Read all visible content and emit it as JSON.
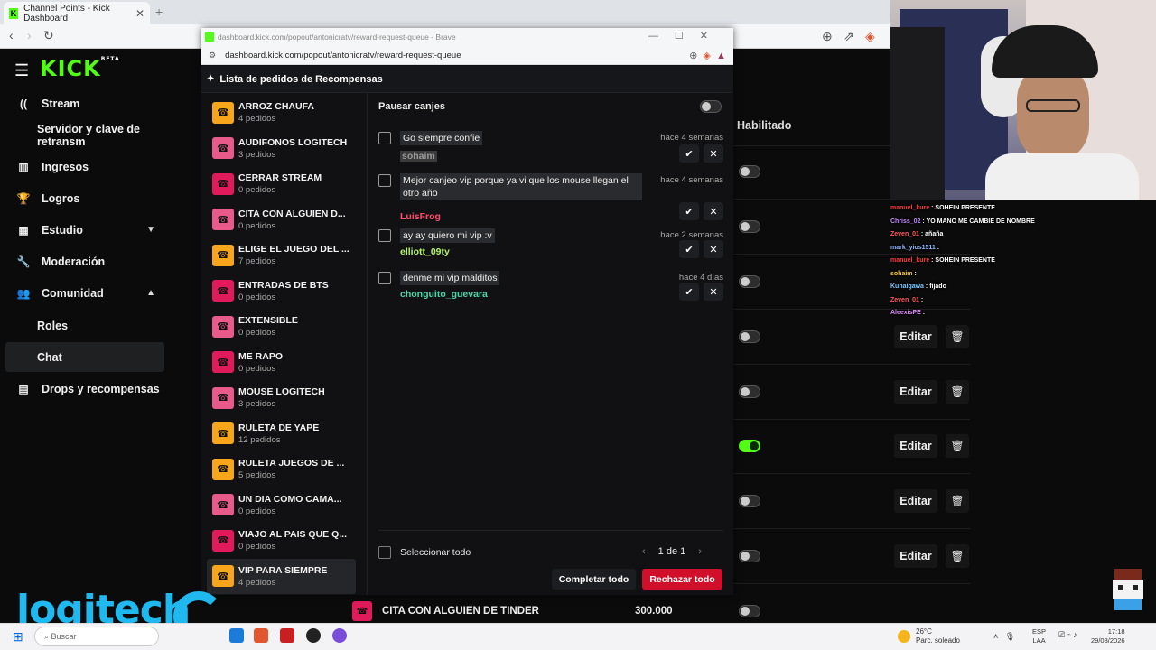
{
  "browser": {
    "tab_title": "Channel Points - Kick Dashboard",
    "tab_close": "✕",
    "new_tab": "+"
  },
  "kick": {
    "logo": "KICK",
    "logo_beta": "BETA",
    "nav": [
      {
        "label": "Stream",
        "icon": "broadcast-icon"
      },
      {
        "label": "Servidor y clave de retransm",
        "icon": ""
      },
      {
        "label": "Ingresos",
        "icon": "chart-icon"
      },
      {
        "label": "Logros",
        "icon": "trophy-icon"
      },
      {
        "label": "Estudio",
        "icon": "studio-icon"
      },
      {
        "label": "Moderación",
        "icon": "wrench-icon"
      },
      {
        "label": "Comunidad",
        "icon": "people-icon"
      },
      {
        "label": "Roles",
        "icon": ""
      },
      {
        "label": "Chat",
        "icon": ""
      },
      {
        "label": "Drops y recompensas",
        "icon": "gift-icon"
      }
    ],
    "table_header": "Habilitado",
    "edit_label": "Editar",
    "bottom_row": {
      "name": "CITA CON ALGUIEN DE TINDER",
      "cost": "300.000"
    },
    "rows_enabled": [
      false,
      false,
      false,
      false,
      false,
      true,
      false,
      false,
      false
    ]
  },
  "popup": {
    "window_title": "dashboard.kick.com/popout/antonicratv/reward-request-queue - Brave",
    "url": "dashboard.kick.com/popout/antonicratv/reward-request-queue",
    "header": "Lista de pedidos de Recompensas",
    "rewards": [
      {
        "name": "ARROZ CHAUFA",
        "count": "4 pedidos",
        "color": "#f7a51b"
      },
      {
        "name": "AUDIFONOS LOGITECH",
        "count": "3 pedidos",
        "color": "#e85a8a"
      },
      {
        "name": "CERRAR STREAM",
        "count": "0 pedidos",
        "color": "#e11a5b"
      },
      {
        "name": "CITA CON ALGUIEN D...",
        "count": "0 pedidos",
        "color": "#e85a8a"
      },
      {
        "name": "ELIGE EL JUEGO DEL ...",
        "count": "7 pedidos",
        "color": "#f7a51b"
      },
      {
        "name": "ENTRADAS DE BTS",
        "count": "0 pedidos",
        "color": "#e11a5b"
      },
      {
        "name": "EXTENSIBLE",
        "count": "0 pedidos",
        "color": "#e85a8a"
      },
      {
        "name": "ME RAPO",
        "count": "0 pedidos",
        "color": "#e11a5b"
      },
      {
        "name": "MOUSE LOGITECH",
        "count": "3 pedidos",
        "color": "#e85a8a"
      },
      {
        "name": "RULETA DE YAPE",
        "count": "12 pedidos",
        "color": "#f7a51b"
      },
      {
        "name": "RULETA JUEGOS DE ...",
        "count": "5 pedidos",
        "color": "#f7a51b"
      },
      {
        "name": "UN DIA COMO CAMA...",
        "count": "0 pedidos",
        "color": "#e85a8a"
      },
      {
        "name": "VIAJO AL PAIS QUE Q...",
        "count": "0 pedidos",
        "color": "#e11a5b"
      },
      {
        "name": "VIP PARA SIEMPRE",
        "count": "4 pedidos",
        "color": "#f7a51b"
      }
    ],
    "pause_label": "Pausar canjes",
    "requests": [
      {
        "message": "Go siempre confie",
        "when": "hace 4 semanas",
        "user": "sohaim",
        "user_color": "#9a9a9a"
      },
      {
        "message": "Mejor canjeo vip porque ya vi que los mouse llegan el otro año",
        "when": "hace 4 semanas",
        "user": "LuisFrog",
        "user_color": "#ff4d6d"
      },
      {
        "message": "ay ay quiero mi vip :v",
        "when": "hace 2 semanas",
        "user": "elliott_09ty",
        "user_color": "#b6f26b"
      },
      {
        "message": "denme mi vip malditos",
        "when": "hace 4 días",
        "user": "chonguito_guevara",
        "user_color": "#4fd6a8"
      }
    ],
    "select_all": "Seleccionar todo",
    "page_indicator": "1 de 1",
    "complete_all": "Completar todo",
    "reject_all": "Rechazar todo"
  },
  "chat": [
    {
      "user": "manuel_kure",
      "text": "SOHEIN PRESENTE",
      "color": "#ff3b3b"
    },
    {
      "user": "Chriss_02",
      "text": "YO MANO ME CAMBIE DE NOMBRE",
      "color": "#c18cff"
    },
    {
      "user": "Zeven_01",
      "text": "añaña",
      "color": "#ff5c5c"
    },
    {
      "user": "mark_yios1511",
      "text": "",
      "color": "#8fb8ff"
    },
    {
      "user": "manuel_kure",
      "text": "SOHEIN PRESENTE",
      "color": "#ff3b3b"
    },
    {
      "user": "sohaim",
      "text": "",
      "color": "#ffcc33"
    },
    {
      "user": "Kunaigawa",
      "text": "fijado",
      "color": "#7ec8ff"
    },
    {
      "user": "Zeven_01",
      "text": "",
      "color": "#ff5c5c"
    },
    {
      "user": "AleexisPE",
      "text": "",
      "color": "#e28cff"
    }
  ],
  "overlay": {
    "logitech": "logitech"
  },
  "taskbar": {
    "search_placeholder": "Buscar",
    "temp": "26°C",
    "weather": "Parc. soleado",
    "lang1": "ESP",
    "lang2": "LAA",
    "time": "17:18",
    "date": "29/03/2026"
  }
}
